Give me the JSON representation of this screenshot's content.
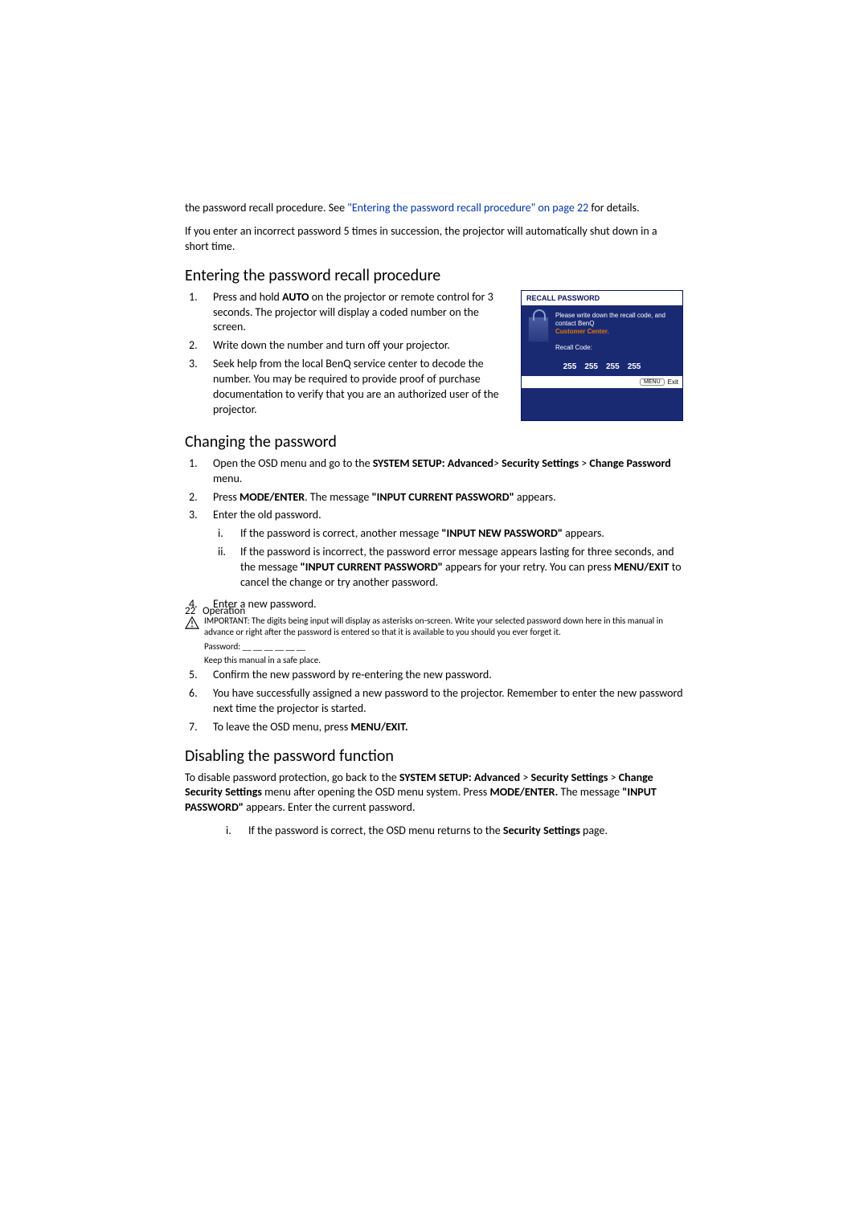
{
  "intro": {
    "line1_prefix": "the password recall procedure. See ",
    "line1_link": "\"Entering the password recall procedure\" on page 22",
    "line1_suffix": " for details.",
    "line2": "If you enter an incorrect password 5 times in succession, the projector will automatically shut down in a short time."
  },
  "recall": {
    "heading": "Entering the password recall procedure",
    "steps": [
      {
        "marker": "1.",
        "text_parts": [
          "Press and hold ",
          "AUTO",
          " on the projector or remote control for 3 seconds. The projector will display a coded number on the screen."
        ]
      },
      {
        "marker": "2.",
        "text_parts": [
          "Write down the number and turn off your projector."
        ]
      },
      {
        "marker": "3.",
        "text_parts": [
          "Seek help from the local BenQ service center to decode the number. You may be required to provide proof of purchase documentation to verify that you are an authorized user of the projector."
        ]
      }
    ]
  },
  "osd": {
    "title": "RECALL PASSWORD",
    "msg_prefix": "Please write down the recall code, and contact BenQ",
    "msg_highlight": "Customer Center.",
    "rc_label": "Recall Code:",
    "codes": [
      "255",
      "255",
      "255",
      "255"
    ],
    "btn_label": "MENU",
    "btn_action": "Exit"
  },
  "changing": {
    "heading": "Changing the password",
    "steps": [
      {
        "marker": "1.",
        "parts": [
          {
            "t": "Open the OSD menu and go to the "
          },
          {
            "t": "SYSTEM SETUP: Advanced",
            "b": true
          },
          {
            "t": "> "
          },
          {
            "t": "Security Settings",
            "b": true
          },
          {
            "t": " > "
          },
          {
            "t": "Change Password",
            "b": true
          },
          {
            "t": " menu."
          }
        ]
      },
      {
        "marker": "2.",
        "parts": [
          {
            "t": "Press "
          },
          {
            "t": "MODE/ENTER",
            "b": true
          },
          {
            "t": ". The message "
          },
          {
            "t": "\"INPUT CURRENT PASSWORD\"",
            "b": true
          },
          {
            "t": " appears."
          }
        ]
      },
      {
        "marker": "3.",
        "parts": [
          {
            "t": "Enter the old password."
          }
        ],
        "sub": [
          {
            "marker": "i.",
            "parts": [
              {
                "t": "If the password is correct, another message "
              },
              {
                "t": "\"INPUT NEW PASSWORD\"",
                "b": true
              },
              {
                "t": " appears."
              }
            ]
          },
          {
            "marker": "ii.",
            "parts": [
              {
                "t": "If the password is incorrect, the password error message appears lasting for three seconds, and the message "
              },
              {
                "t": "\"INPUT CURRENT PASSWORD\"",
                "b": true
              },
              {
                "t": " appears for your retry. You can press "
              },
              {
                "t": "MENU/EXIT",
                "b": true
              },
              {
                "t": " to cancel the change or try another password."
              }
            ]
          }
        ]
      },
      {
        "marker": "4.",
        "parts": [
          {
            "t": "Enter a new password."
          }
        ]
      }
    ],
    "note": "IMPORTANT: The digits being input will display as asterisks on-screen. Write your selected password down here in this manual in advance or right after the password is entered so that it is available to you should you ever forget it.",
    "password_line": "Password: __ __ __ __ __ __",
    "keep_line": "Keep this manual in a safe place.",
    "steps2": [
      {
        "marker": "5.",
        "parts": [
          {
            "t": "Confirm the new password by re-entering the new password."
          }
        ]
      },
      {
        "marker": "6.",
        "parts": [
          {
            "t": "You have successfully assigned a new password to the projector. Remember to enter the new password next time the projector is started."
          }
        ]
      },
      {
        "marker": "7.",
        "parts": [
          {
            "t": "To leave the OSD menu, press "
          },
          {
            "t": "MENU/EXIT.",
            "b": true
          }
        ]
      }
    ]
  },
  "disabling": {
    "heading": "Disabling the password function",
    "para_parts": [
      {
        "t": "To disable password protection, go back to the "
      },
      {
        "t": "SYSTEM SETUP: Advanced",
        "b": true
      },
      {
        "t": " > "
      },
      {
        "t": "Security Settings",
        "b": true
      },
      {
        "t": " > "
      },
      {
        "t": "Change Security Settings",
        "b": true
      },
      {
        "t": " menu after opening the OSD menu system. Press "
      },
      {
        "t": "MODE/ENTER.",
        "b": true
      },
      {
        "t": " The message "
      },
      {
        "t": "\"INPUT PASSWORD\"",
        "b": true
      },
      {
        "t": " appears. Enter the current password."
      }
    ],
    "sub": [
      {
        "marker": "i.",
        "parts": [
          {
            "t": "If the password is correct, the OSD menu returns to the "
          },
          {
            "t": "Security Settings",
            "b": true
          },
          {
            "t": " page."
          }
        ]
      }
    ]
  },
  "footer": {
    "page": "22",
    "section": "Operation"
  }
}
